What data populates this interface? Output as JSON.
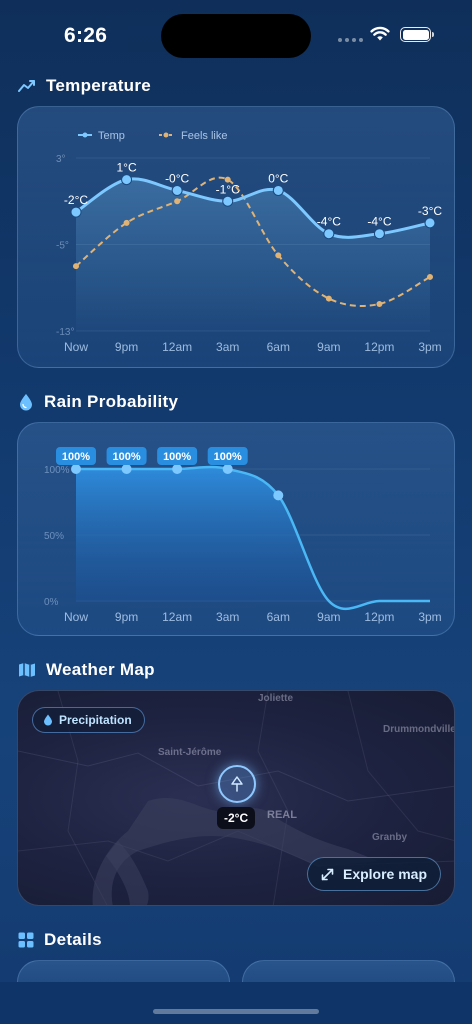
{
  "status_bar": {
    "time": "6:26"
  },
  "sections": {
    "temperature": "Temperature",
    "rain": "Rain Probability",
    "map": "Weather Map",
    "details": "Details"
  },
  "chart_data": [
    {
      "type": "line",
      "x": [
        "Now",
        "9pm",
        "12am",
        "3am",
        "6am",
        "9am",
        "12pm",
        "3pm"
      ],
      "series": [
        {
          "name": "Temp",
          "values": [
            -2,
            1,
            0,
            -1,
            0,
            -4,
            -4,
            -3
          ],
          "labels": [
            "-2°C",
            "1°C",
            "-0°C",
            "-1°C",
            "0°C",
            "-4°C",
            "-4°C",
            "-3°C"
          ]
        },
        {
          "name": "Feels like",
          "values": [
            -7,
            -3,
            -1,
            1,
            -6,
            -10,
            -10.5,
            -8
          ]
        }
      ],
      "y_ticks": [
        "3°",
        "-5°",
        "-13°"
      ],
      "ylim": [
        -13,
        3
      ],
      "colors": {
        "temp": "#7cc8ff",
        "feels": "#e0b374"
      },
      "legend": "top-left"
    },
    {
      "type": "area",
      "x": [
        "Now",
        "9pm",
        "12am",
        "3am",
        "6am",
        "9am",
        "12pm",
        "3pm"
      ],
      "series": [
        {
          "name": "Rain probability",
          "values": [
            100,
            100,
            100,
            100,
            80,
            0,
            0,
            0
          ]
        }
      ],
      "badges": [
        "100%",
        "100%",
        "100%",
        "100%"
      ],
      "y_ticks": [
        "100%",
        "50%",
        "0%"
      ],
      "ylim": [
        0,
        100
      ],
      "colors": {
        "line": "#4ab8f5"
      }
    }
  ],
  "map": {
    "chip_label": "Precipitation",
    "pin_temp": "-2°C",
    "explore_label": "Explore map",
    "places": [
      "Joliette",
      "Drummondville",
      "Saint-Jérôme",
      "REAL",
      "Granby"
    ]
  }
}
